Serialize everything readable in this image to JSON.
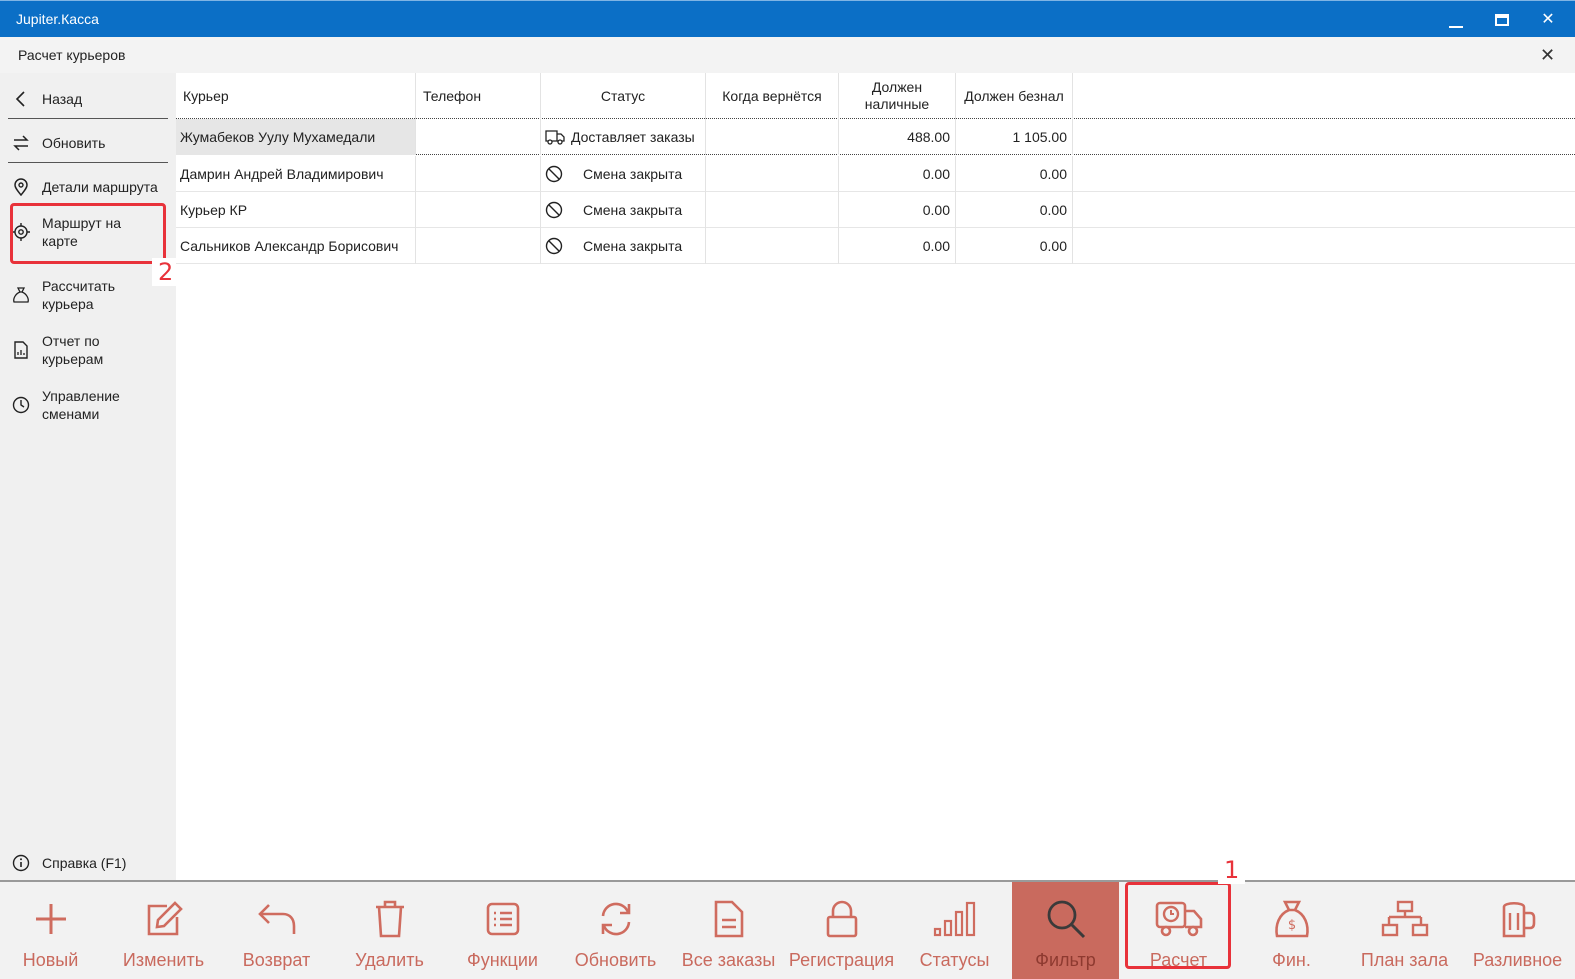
{
  "window": {
    "title": "Jupiter.Касса"
  },
  "page": {
    "title": "Расчет курьеров"
  },
  "sidebar": {
    "items": [
      {
        "label": "Назад",
        "icon": "chevron-left-icon"
      },
      {
        "label": "Обновить",
        "icon": "refresh-arrows-icon"
      },
      {
        "label": "Детали маршрута",
        "icon": "map-pin-icon"
      },
      {
        "label": "Маршрут на карте",
        "icon": "crosshair-icon"
      },
      {
        "label": "Рассчитать курьера",
        "icon": "money-bag-icon"
      },
      {
        "label": "Отчет по курьерам",
        "icon": "report-document-icon"
      },
      {
        "label": "Управление сменами",
        "icon": "clock-icon"
      }
    ],
    "help_label": "Справка (F1)"
  },
  "table": {
    "columns": [
      "Курьер",
      "Телефон",
      "Статус",
      "Когда вернётся",
      "Должен наличные",
      "Должен безнал"
    ],
    "rows": [
      {
        "courier": "Жумабеков Уулу Мухамедали",
        "phone": "",
        "status": "Доставляет заказы",
        "status_icon": "delivery-truck-icon",
        "return_time": "",
        "owed_cash": "488.00",
        "owed_cashless": "1 105.00",
        "selected": true
      },
      {
        "courier": "Дамрин Андрей Владимирович",
        "phone": "",
        "status": "Смена закрыта",
        "status_icon": "blocked-circle-icon",
        "return_time": "",
        "owed_cash": "0.00",
        "owed_cashless": "0.00"
      },
      {
        "courier": "Курьер КР",
        "phone": "",
        "status": "Смена закрыта",
        "status_icon": "blocked-circle-icon",
        "return_time": "",
        "owed_cash": "0.00",
        "owed_cashless": "0.00"
      },
      {
        "courier": "Сальников Александр Борисович",
        "phone": "",
        "status": "Смена закрыта",
        "status_icon": "blocked-circle-icon",
        "return_time": "",
        "owed_cash": "0.00",
        "owed_cashless": "0.00"
      }
    ]
  },
  "toolbar": {
    "buttons": [
      {
        "label": "Новый",
        "icon": "plus-icon"
      },
      {
        "label": "Изменить",
        "icon": "edit-icon"
      },
      {
        "label": "Возврат",
        "icon": "undo-icon"
      },
      {
        "label": "Удалить",
        "icon": "trash-icon"
      },
      {
        "label": "Функции",
        "icon": "list-icon"
      },
      {
        "label": "Обновить",
        "icon": "refresh-icon"
      },
      {
        "label": "Все заказы",
        "icon": "document-icon"
      },
      {
        "label": "Регистрация",
        "icon": "lock-icon"
      },
      {
        "label": "Статусы",
        "icon": "bar-chart-icon"
      },
      {
        "label": "Фильтр",
        "icon": "search-icon",
        "active": true
      },
      {
        "label": "Расчет",
        "icon": "delivery-truck-icon"
      },
      {
        "label": "Фин.",
        "icon": "money-bag-icon"
      },
      {
        "label": "План зала",
        "icon": "floor-plan-icon"
      },
      {
        "label": "Разливное",
        "icon": "beer-mug-icon"
      }
    ]
  },
  "annotations": {
    "marker_1": "1",
    "marker_2": "2"
  },
  "colors": {
    "titlebar": "#0b6fc6",
    "accent": "#c96a5e",
    "highlight": "#e8323a"
  }
}
